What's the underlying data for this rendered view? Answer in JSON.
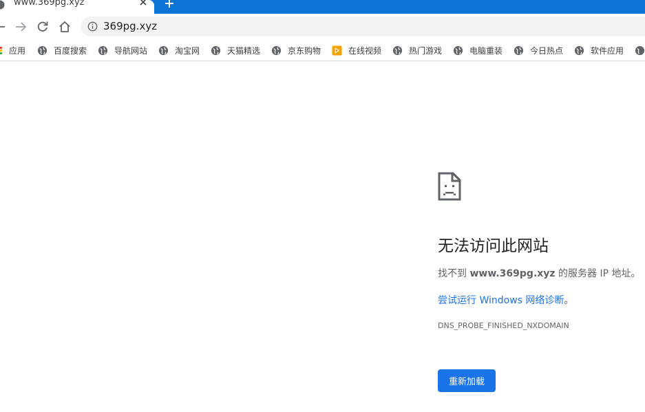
{
  "tab": {
    "title": "www.369pg.xyz"
  },
  "toolbar": {
    "url": "369pg.xyz"
  },
  "bookmarks": [
    {
      "label": "应用",
      "icon": "apps-grid-icon"
    },
    {
      "label": "百度搜索",
      "icon": "globe-icon"
    },
    {
      "label": "导航网站",
      "icon": "globe-icon"
    },
    {
      "label": "淘宝网",
      "icon": "globe-icon"
    },
    {
      "label": "天猫精选",
      "icon": "globe-icon"
    },
    {
      "label": "京东购物",
      "icon": "globe-icon"
    },
    {
      "label": "在线视频",
      "icon": "video-play-icon"
    },
    {
      "label": "热门游戏",
      "icon": "globe-icon"
    },
    {
      "label": "电脑重装",
      "icon": "globe-icon"
    },
    {
      "label": "今日热点",
      "icon": "globe-icon"
    },
    {
      "label": "软件应用",
      "icon": "globe-icon"
    }
  ],
  "error": {
    "title": "无法访问此网站",
    "desc_prefix": "找不到 ",
    "desc_host": "www.369pg.xyz",
    "desc_suffix": " 的服务器 IP 地址。",
    "suggestion_link": "尝试运行 Windows 网络诊断",
    "suggestion_tail": "。",
    "code": "DNS_PROBE_FINISHED_NXDOMAIN",
    "reload_label": "重新加载"
  },
  "colors": {
    "tabstrip": "#0b74d4",
    "accent": "#1a73e8",
    "omnibox": "#f1f3f4"
  }
}
